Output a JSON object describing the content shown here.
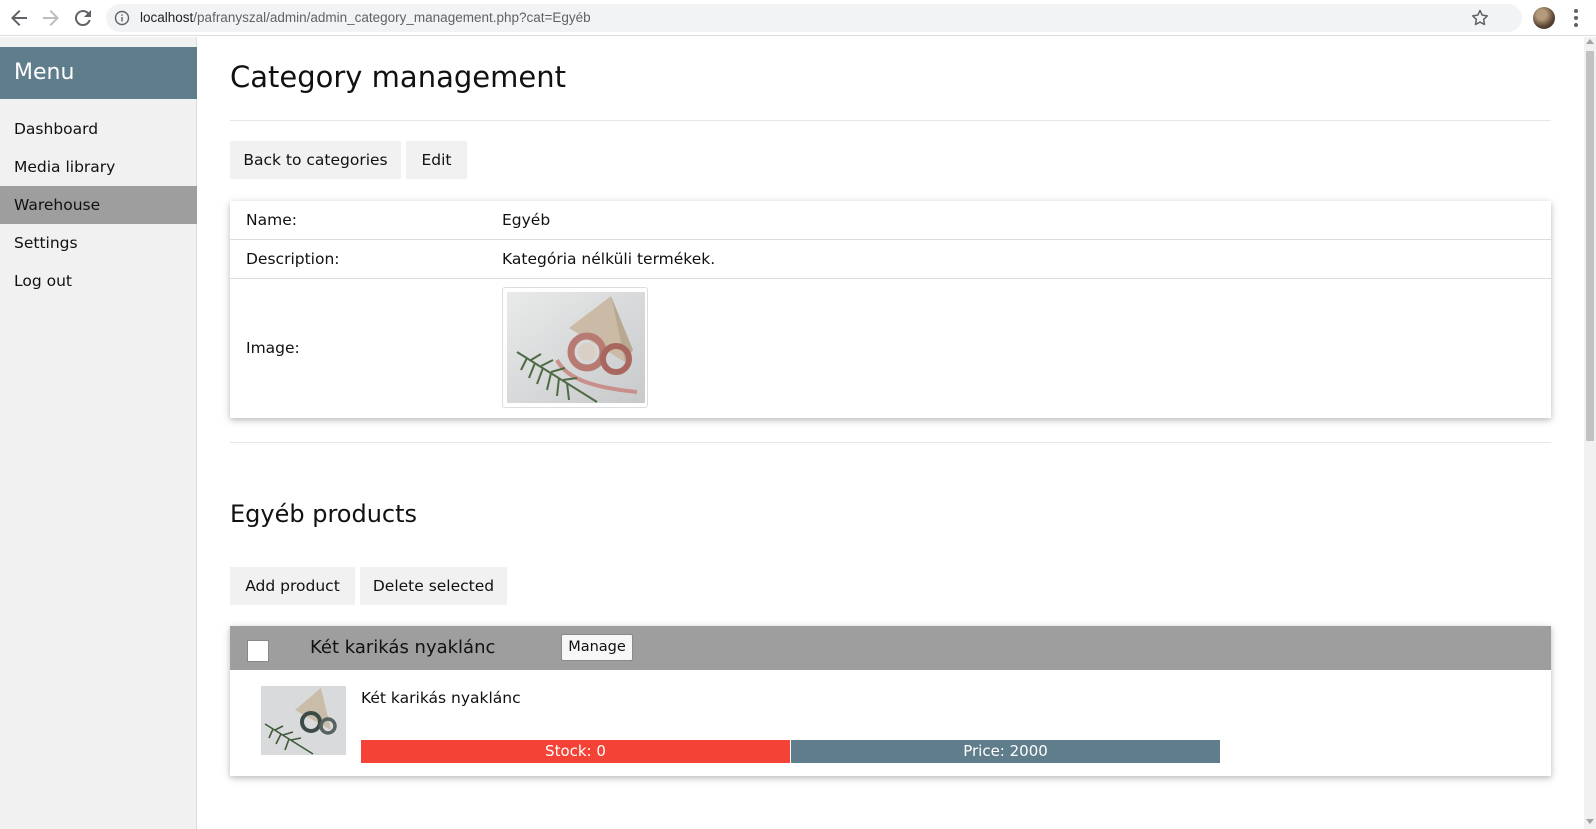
{
  "browser": {
    "url_host": "localhost",
    "url_path": "/pafranyszal/admin/admin_category_management.php?cat=Egyéb"
  },
  "sidebar": {
    "title": "Menu",
    "items": [
      {
        "label": "Dashboard",
        "active": false
      },
      {
        "label": "Media library",
        "active": false
      },
      {
        "label": "Warehouse",
        "active": true
      },
      {
        "label": "Settings",
        "active": false
      },
      {
        "label": "Log out",
        "active": false
      }
    ]
  },
  "main": {
    "title": "Category management",
    "back_button": "Back to categories",
    "edit_button": "Edit",
    "details": {
      "name_label": "Name:",
      "name_value": "Egyéb",
      "description_label": "Description:",
      "description_value": "Kategória nélküli termékek.",
      "image_label": "Image:"
    },
    "products_title": "Egyéb products",
    "add_product_button": "Add product",
    "delete_selected_button": "Delete selected",
    "products": [
      {
        "header_name": "Két karikás nyaklánc",
        "manage_label": "Manage",
        "name": "Két karikás nyaklánc",
        "stock_text": "Stock: 0",
        "price_text": "Price: 2000"
      }
    ]
  },
  "colors": {
    "accent": "#607d8b",
    "active_item": "#9e9e9e",
    "stock_bar": "#f44336",
    "price_bar": "#607d8b"
  },
  "icons": [
    "back-arrow-icon",
    "forward-arrow-icon",
    "reload-icon",
    "info-icon",
    "star-icon",
    "kebab-menu-icon"
  ]
}
